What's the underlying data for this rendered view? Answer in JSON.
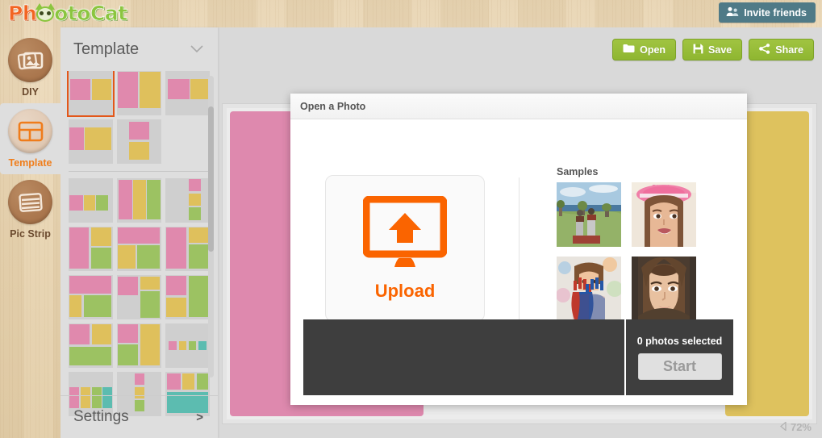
{
  "app": {
    "logo_part1": "Ph",
    "logo_part2": "oto",
    "logo_part3": "Cat",
    "invite_label": "Invite friends",
    "invite_icon": "people-icon",
    "invite_bg": "#4f7a87"
  },
  "rail": {
    "items": [
      {
        "label": "DIY",
        "icon": "photos-stack-icon",
        "active": false
      },
      {
        "label": "Template",
        "icon": "grid-layout-icon",
        "active": true
      },
      {
        "label": "Pic Strip",
        "icon": "film-strip-icon",
        "active": false
      }
    ],
    "active_color": "#f07d1a",
    "inactive_color": "#6b4a2e"
  },
  "panel": {
    "title": "Template",
    "collapse_icon": "chevron-down-icon",
    "settings_label": "Settings",
    "settings_icon": "chevron-right-icon",
    "selected_index": 0,
    "swatches": {
      "pink": "#e089ad",
      "yellow": "#dfc05c",
      "green": "#9cc262",
      "teal": "#5cbcb0",
      "grey": "#cfcfcf"
    }
  },
  "toolbar": {
    "buttons": [
      {
        "label": "Open",
        "icon": "folder-icon"
      },
      {
        "label": "Save",
        "icon": "floppy-disk-icon"
      },
      {
        "label": "Share",
        "icon": "share-nodes-icon"
      }
    ],
    "button_color": "#95bb34"
  },
  "canvas": {
    "left_block_color": "#de89ae",
    "right_block_color": "#dec25e",
    "zoom_level": "72%",
    "zoom_arrow_icon": "triangle-left-icon"
  },
  "modal": {
    "title": "Open a Photo",
    "upload": {
      "label": "Upload",
      "icon": "monitor-upload-icon",
      "color": "#fa6400"
    },
    "samples_label": "Samples",
    "samples": [
      {
        "name": "beach-riders-photo",
        "alt": "Two riders on a grassy coastal hill"
      },
      {
        "name": "girl-pink-hat-photo",
        "alt": "Young girl wearing a pink hat"
      },
      {
        "name": "painted-hands-photo",
        "alt": "Child with red and blue painted hands"
      },
      {
        "name": "woman-portrait-photo",
        "alt": "Portrait of a brunette woman"
      }
    ],
    "footer": {
      "selected_count": "0",
      "selected_text": "photos selected",
      "start_label": "Start",
      "start_enabled": false
    }
  }
}
